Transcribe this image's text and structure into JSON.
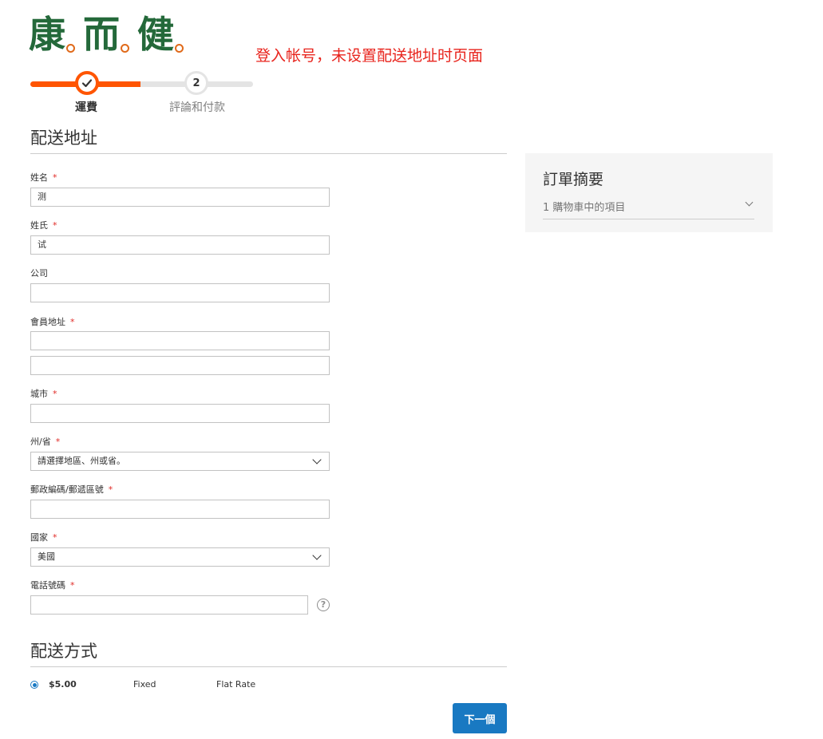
{
  "logo": {
    "chars": [
      "康",
      "而",
      "健"
    ]
  },
  "annotation": "登入帐号，未设置配送地址时页面",
  "progress": {
    "steps": [
      {
        "label": "運費",
        "state": "active"
      },
      {
        "number": "2",
        "label": "評論和付款",
        "state": "todo"
      }
    ]
  },
  "shipping_address": {
    "title": "配送地址",
    "fields": {
      "first_name": {
        "label": "姓名",
        "value": "测",
        "required": "*"
      },
      "last_name": {
        "label": "姓氏",
        "value": "试",
        "required": "*"
      },
      "company": {
        "label": "公司",
        "value": ""
      },
      "street": {
        "label": "會員地址",
        "value": "",
        "value2": "",
        "required": "*"
      },
      "city": {
        "label": "城市",
        "value": "",
        "required": "*"
      },
      "region": {
        "label": "州/省",
        "value": "請選擇地區、州或省。",
        "required": "*"
      },
      "postcode": {
        "label": "郵政編碼/郵遞區號",
        "value": "",
        "required": "*"
      },
      "country": {
        "label": "國家",
        "value": "美國",
        "required": "*"
      },
      "telephone": {
        "label": "電話號碼",
        "value": "",
        "required": "*"
      }
    },
    "help_icon": "question-circle-icon",
    "help_glyph": "?"
  },
  "shipping_method": {
    "title": "配送方式",
    "options": [
      {
        "price": "$5.00",
        "method": "Fixed",
        "carrier": "Flat Rate",
        "selected": true
      }
    ]
  },
  "next_button": "下一個",
  "order_summary": {
    "title": "訂單摘要",
    "items_label": "1 購物車中的項目"
  },
  "colors": {
    "accent": "#ff5501",
    "button": "#1979c2",
    "required": "#e02b27",
    "annotation": "#e8231c",
    "logo": "#24693a"
  }
}
